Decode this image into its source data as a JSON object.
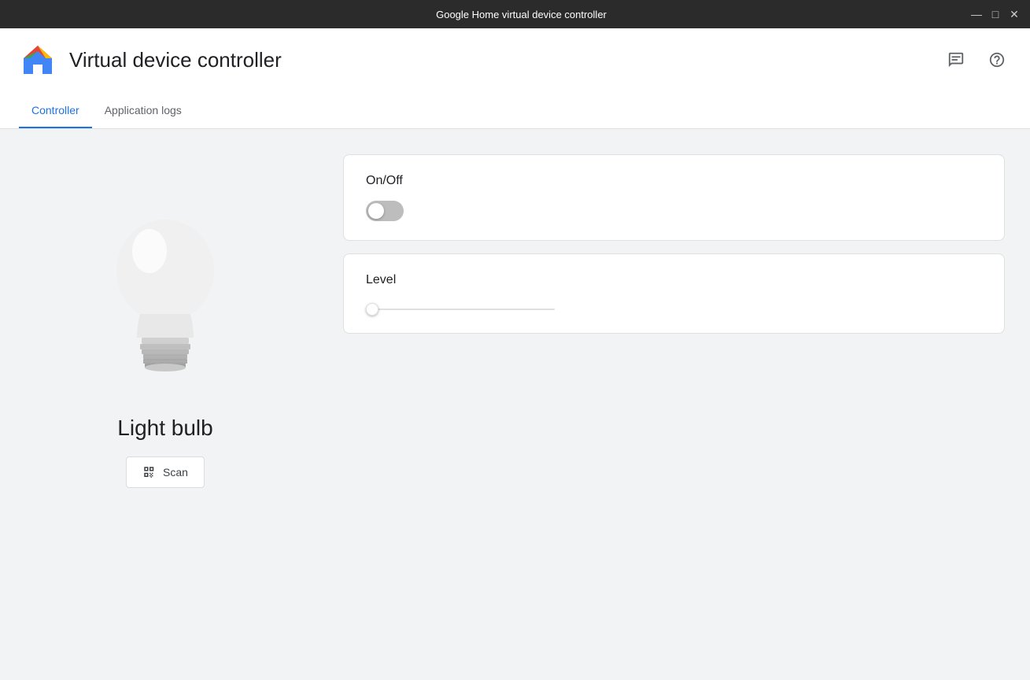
{
  "titleBar": {
    "title": "Google Home virtual device controller",
    "controls": {
      "minimize": "—",
      "maximize": "□",
      "close": "✕"
    }
  },
  "header": {
    "appTitle": "Virtual device controller",
    "icons": {
      "chat": "💬",
      "help": "?"
    }
  },
  "tabs": [
    {
      "id": "controller",
      "label": "Controller",
      "active": true
    },
    {
      "id": "application-logs",
      "label": "Application logs",
      "active": false
    }
  ],
  "leftPanel": {
    "deviceName": "Light bulb",
    "scanButton": "Scan"
  },
  "rightPanel": {
    "controls": [
      {
        "id": "on-off",
        "label": "On/Off",
        "type": "toggle",
        "value": false
      },
      {
        "id": "level",
        "label": "Level",
        "type": "slider",
        "value": 0,
        "min": 0,
        "max": 100
      }
    ]
  }
}
